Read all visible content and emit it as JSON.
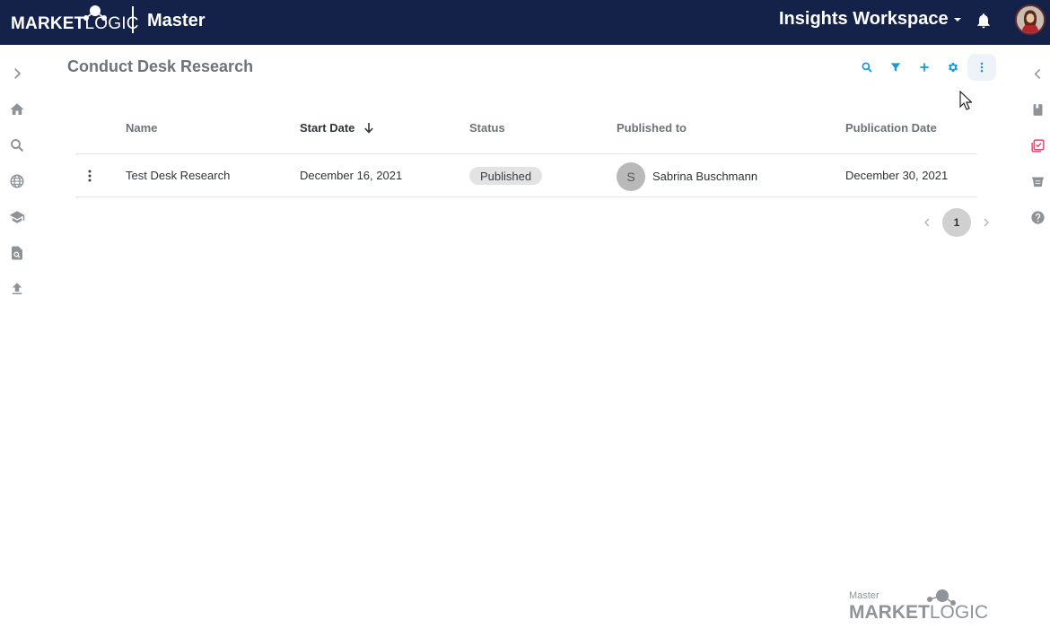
{
  "header": {
    "logo_strong": "MARKET",
    "logo_light": "LOGIC",
    "app_name": "Master",
    "workspace": "Insights Workspace"
  },
  "page": {
    "title": "Conduct Desk Research"
  },
  "table": {
    "columns": [
      "Name",
      "Start Date",
      "Status",
      "Published to",
      "Publication Date"
    ],
    "rows": [
      {
        "name": "Test Desk Research",
        "start_date": "December 16, 2021",
        "status": "Published",
        "published_initial": "S",
        "published_to": "Sabrina Buschmann",
        "publication_date": "December 30, 2021"
      }
    ]
  },
  "pagination": {
    "current": "1"
  },
  "footer": {
    "master": "Master",
    "brand_strong": "MARKET",
    "brand_light": "LOGIC"
  },
  "colors": {
    "header_bg": "#14224a",
    "accent": "#1a9ad6",
    "alert": "#e0486a"
  }
}
